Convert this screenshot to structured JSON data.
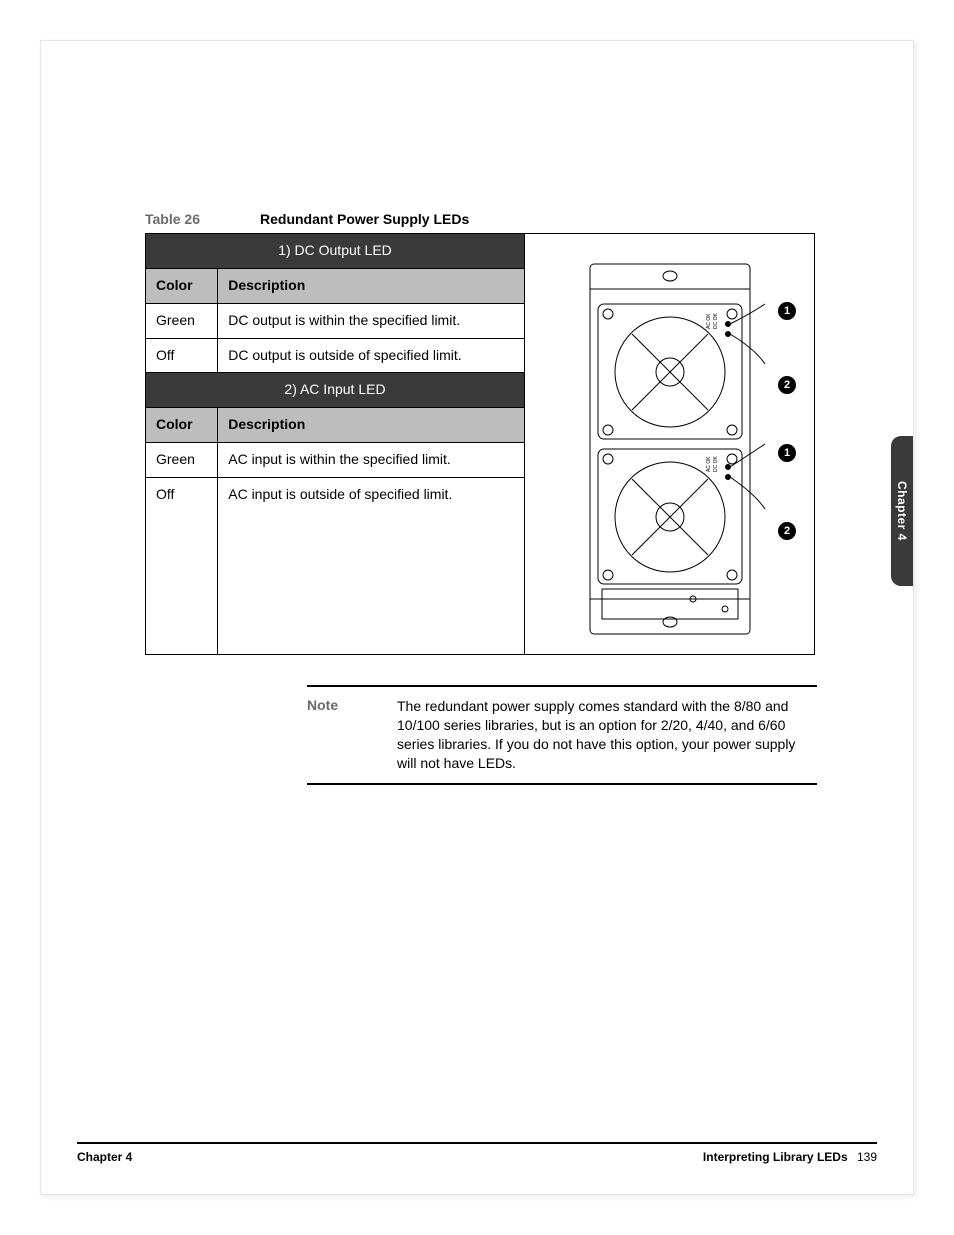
{
  "sideTab": "Chapter 4",
  "caption": {
    "label": "Table 26",
    "title": "Redundant Power Supply LEDs"
  },
  "sections": [
    {
      "title": "1) DC Output LED",
      "header": {
        "c1": "Color",
        "c2": "Description"
      },
      "rows": [
        {
          "c1": "Green",
          "c2": "DC output is within the specified limit."
        },
        {
          "c1": "Off",
          "c2": "DC output is outside of specified limit."
        }
      ]
    },
    {
      "title": "2) AC Input LED",
      "header": {
        "c1": "Color",
        "c2": "Description"
      },
      "rows": [
        {
          "c1": "Green",
          "c2": "AC input is within the specified limit."
        },
        {
          "c1": "Off",
          "c2": "AC input is outside of specified limit."
        }
      ]
    }
  ],
  "figure": {
    "labels": {
      "ac": "AC OK",
      "dc": "DC OK"
    },
    "callouts": [
      "1",
      "2",
      "1",
      "2"
    ]
  },
  "note": {
    "label": "Note",
    "text": "The redundant power supply comes standard with the 8/80 and 10/100 series libraries, but is an option for 2/20, 4/40, and 6/60 series libraries. If you do not have this option, your power supply will not have LEDs."
  },
  "footer": {
    "left": "Chapter 4",
    "rightTitle": "Interpreting Library LEDs",
    "page": "139"
  }
}
